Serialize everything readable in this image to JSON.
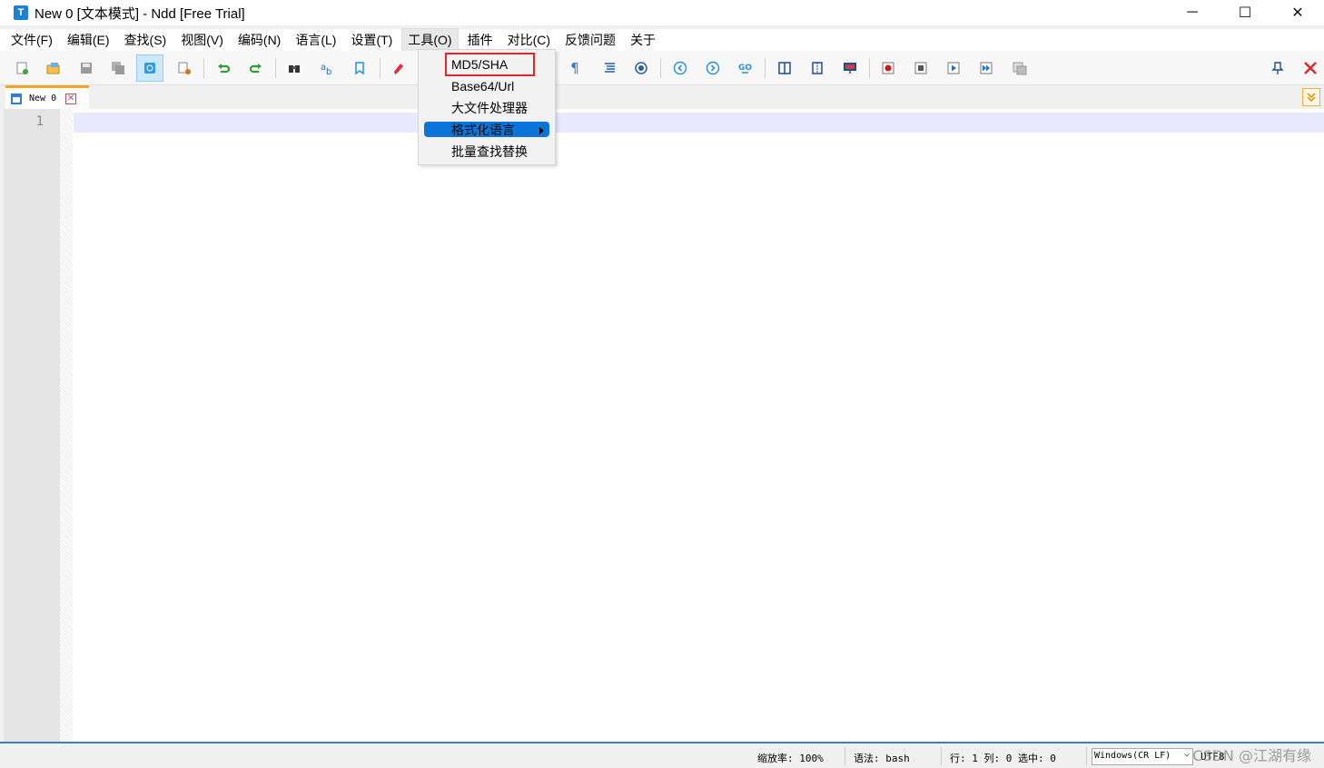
{
  "window": {
    "title": "New 0 [文本模式] - Ndd [Free Trial]",
    "app_icon": "T",
    "controls": {
      "minimize": "─",
      "maximize": "☐",
      "close": "✕"
    }
  },
  "menubar": {
    "items": [
      "文件(F)",
      "编辑(E)",
      "查找(S)",
      "视图(V)",
      "编码(N)",
      "语言(L)",
      "设置(T)",
      "工具(O)",
      "插件",
      "对比(C)",
      "反馈问题",
      "关于"
    ],
    "active_index": 7
  },
  "tools_menu": {
    "items": [
      "MD5/SHA",
      "Base64/Url",
      "大文件处理器",
      "格式化语言",
      "批量查找替换"
    ],
    "highlighted_index": 3,
    "boxed_index": 0,
    "submenu_index": 3
  },
  "tabs": [
    {
      "label": "New 0",
      "close": "✕"
    }
  ],
  "editor": {
    "line_numbers": [
      "1"
    ]
  },
  "statusbar": {
    "zoom": "缩放率: 100%",
    "syntax": "语法: bash",
    "position": "行: 1 列: 0 选中: 0",
    "line_ending": "Windows(CR LF)",
    "encoding": "UTF8"
  },
  "watermark": "CSDN @江湖有缘",
  "colors": {
    "accent": "#3d7cc9",
    "highlight": "#0a74d8",
    "tab_accent": "#f5a623",
    "close_red": "#e0282c"
  },
  "toolbar_icons": [
    "new-file-icon",
    "open-file-icon",
    "save-icon",
    "save-all-icon",
    "text-mode-icon",
    "close-file-icon",
    "undo-icon",
    "redo-icon",
    "find-icon",
    "replace-icon",
    "bookmark-icon",
    "clear-icon",
    "show-symbols-icon",
    "indent-guide-icon",
    "wrap-icon",
    "prev-icon",
    "next-icon",
    "goto-icon",
    "split-view-icon",
    "column-view-icon",
    "monitor-icon",
    "record-macro-icon",
    "stop-macro-icon",
    "play-macro-icon",
    "run-macro-multi-icon",
    "save-macro-icon",
    "pin-icon",
    "close-app-icon"
  ]
}
